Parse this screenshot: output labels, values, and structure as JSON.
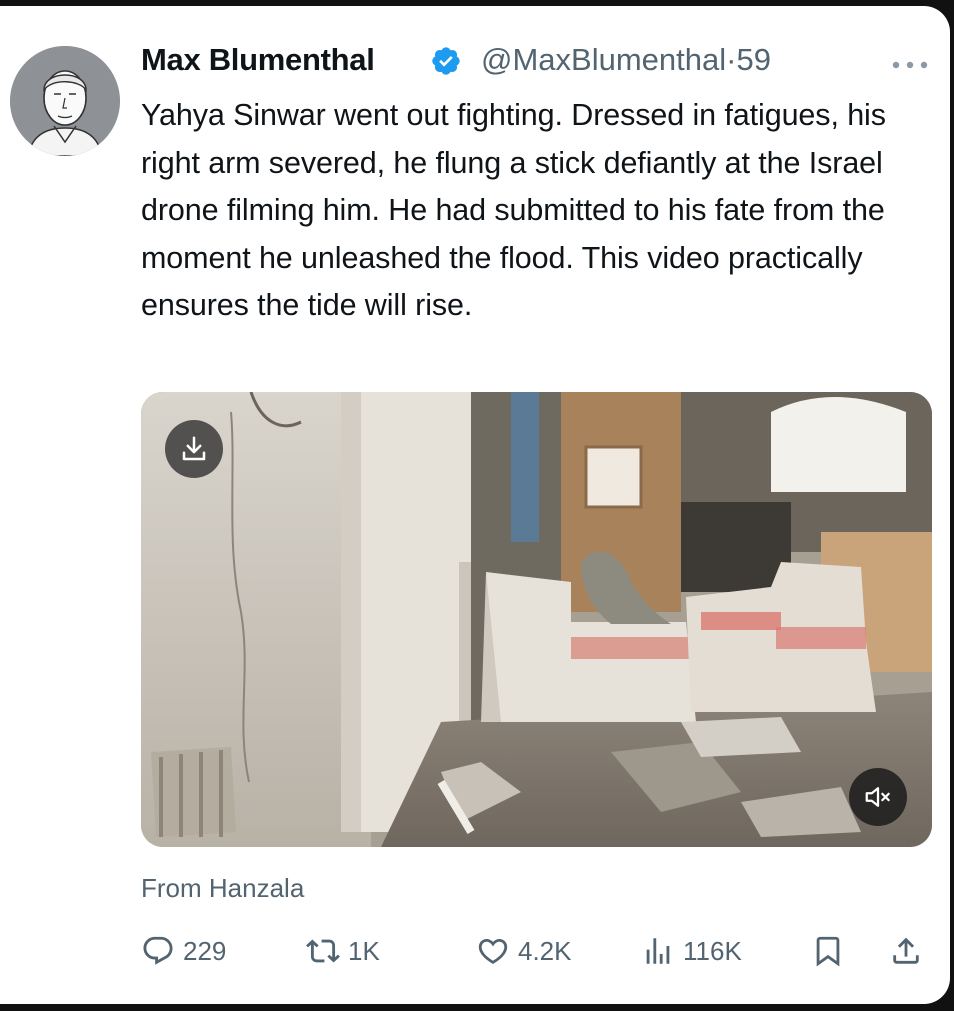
{
  "tweet": {
    "author": {
      "name": "Max Blumenthal",
      "handle": "@MaxBlumenthal",
      "separator": "·",
      "time": "59",
      "verified": true,
      "avatar_icon": "avatar-sketch-portrait"
    },
    "text": "Yahya Sinwar went out fighting. Dressed in fatigues, his right arm severed, he flung a stick defiantly at the Israel drone filming him. He had submitted to his fate from the moment he unleashed the flood. This video practically ensures the tide will rise.",
    "media": {
      "type": "video",
      "download_icon": "download-icon",
      "mute_icon": "speaker-muted-icon"
    },
    "source_label": "From Hanzala",
    "stats": {
      "replies": "229",
      "reposts": "1K",
      "likes": "4.2K",
      "views": "116K"
    },
    "icons": [
      "reply-icon",
      "repost-icon",
      "like-icon",
      "views-icon",
      "bookmark-icon",
      "share-icon",
      "more-icon",
      "verified-badge-icon"
    ]
  },
  "colors": {
    "text_primary": "#0f1419",
    "text_secondary": "#536471",
    "verified_blue": "#1d9bf0",
    "background": "#ffffff"
  }
}
